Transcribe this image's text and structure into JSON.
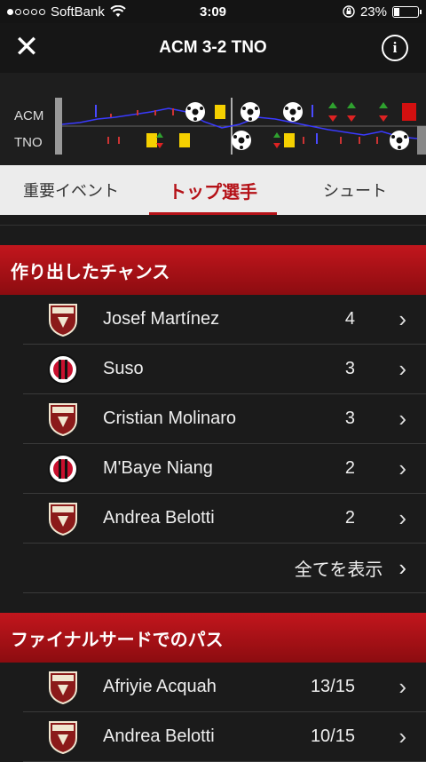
{
  "status_bar": {
    "carrier": "SoftBank",
    "time": "3:09",
    "battery": "23%",
    "battery_level": 0.23
  },
  "header": {
    "title": "ACM 3-2 TNO",
    "close_icon": "close-icon",
    "info_icon": "info-icon",
    "info_glyph": "i",
    "close_glyph": "✕"
  },
  "timeline": {
    "home_team": "ACM",
    "away_team": "TNO"
  },
  "tabs": [
    {
      "label": "重要イベント",
      "active": false
    },
    {
      "label": "トップ選手",
      "active": true
    },
    {
      "label": "シュート",
      "active": false
    }
  ],
  "sections": [
    {
      "title": "作り出したチャンス",
      "rows": [
        {
          "name": "Josef Martínez",
          "value": "4",
          "team": "TNO"
        },
        {
          "name": "Suso",
          "value": "3",
          "team": "ACM"
        },
        {
          "name": "Cristian Molinaro",
          "value": "3",
          "team": "TNO"
        },
        {
          "name": "M'Baye Niang",
          "value": "2",
          "team": "ACM"
        },
        {
          "name": "Andrea Belotti",
          "value": "2",
          "team": "TNO"
        }
      ],
      "show_all": "全てを表示"
    },
    {
      "title": "ファイナルサードでのパス",
      "rows": [
        {
          "name": "Afriyie Acquah",
          "value": "13/15",
          "team": "TNO"
        },
        {
          "name": "Andrea Belotti",
          "value": "10/15",
          "team": "TNO"
        }
      ]
    }
  ],
  "colors": {
    "accent": "#b51218",
    "tab_bg": "#ececec",
    "background": "#1b1b1b"
  }
}
